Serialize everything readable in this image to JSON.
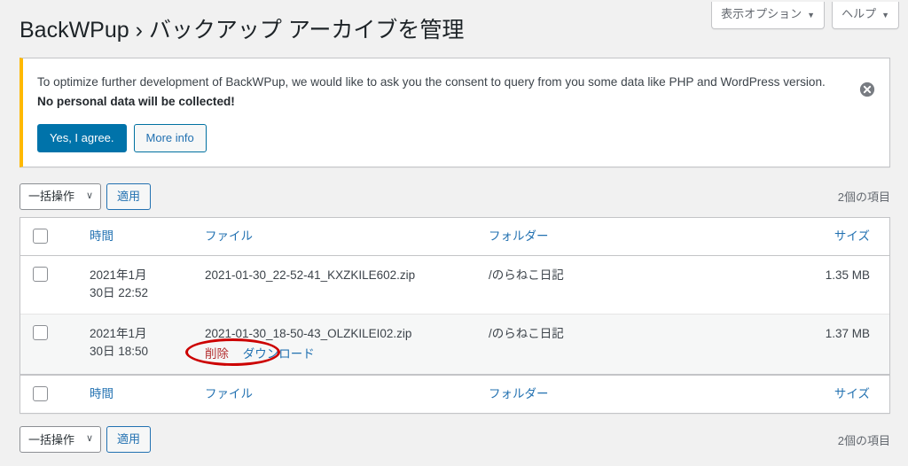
{
  "header": {
    "screen_options_label": "表示オプション",
    "help_label": "ヘルプ",
    "caret": "▼",
    "page_title": "BackWPup › バックアップ アーカイブを管理"
  },
  "notice": {
    "text_part1": "To optimize further development of BackWPup, we would like to ask you the consent to query from you some data like PHP and WordPress version. ",
    "text_bold": "No personal data will be collected!",
    "agree_label": "Yes, I agree.",
    "more_info_label": "More info",
    "dismiss_icon": "dismiss-circle-x-icon",
    "accent_color": "#ffb900"
  },
  "tablenav_top": {
    "bulk_action_label": "一括操作",
    "bulk_chevron": "∨",
    "apply_label": "適用",
    "displaying_num": "2個の項目"
  },
  "tablenav_bottom": {
    "bulk_action_label": "一括操作",
    "bulk_chevron": "∨",
    "apply_label": "適用",
    "displaying_num": "2個の項目"
  },
  "table": {
    "columns": {
      "time": "時間",
      "file": "ファイル",
      "folder": "フォルダー",
      "size": "サイズ"
    },
    "rows": [
      {
        "time_line1": "2021年1月",
        "time_line2": "30日 22:52",
        "file": "2021-01-30_22-52-41_KXZKILE602.zip",
        "folder": "/のらねこ日記",
        "size": "1.35 MB",
        "actions": {
          "delete": "",
          "download": ""
        }
      },
      {
        "time_line1": "2021年1月",
        "time_line2": "30日 18:50",
        "file": "2021-01-30_18-50-43_OLZKILEI02.zip",
        "folder": "/のらねこ日記",
        "size": "1.37 MB",
        "actions": {
          "delete": "削除",
          "download": "ダウンロード"
        }
      }
    ]
  },
  "annotation": {
    "shape": "ellipse",
    "color": "#cc0000",
    "target": "ダウンロード"
  }
}
